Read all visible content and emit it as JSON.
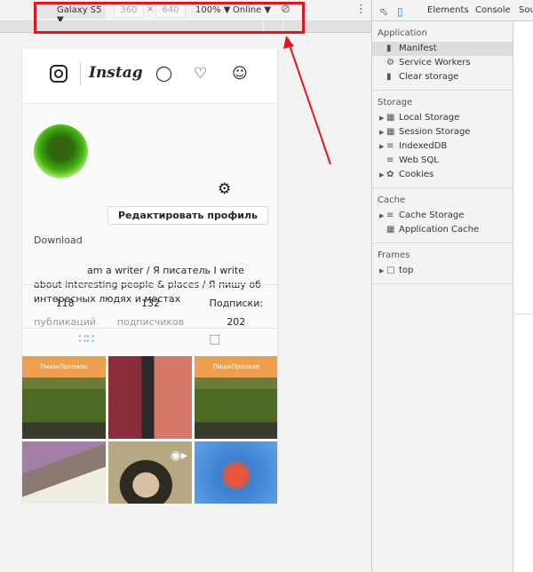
{
  "device_toolbar": {
    "device": "Galaxy S5 ▼",
    "width": "360",
    "times": "×",
    "height": "640",
    "zoom": "100% ▼",
    "network": "Online ▼",
    "rotate_icon": "rotate-icon",
    "menu_icon": "⋮"
  },
  "devtools": {
    "tabs": [
      "Elements",
      "Console",
      "Sou"
    ],
    "sections": [
      {
        "title": "Application",
        "items": [
          {
            "label": "Manifest",
            "icon": "▮",
            "selected": true
          },
          {
            "label": "Service Workers",
            "icon": "⚙"
          },
          {
            "label": "Clear storage",
            "icon": "▮"
          }
        ]
      },
      {
        "title": "Storage",
        "items": [
          {
            "label": "Local Storage",
            "icon": "▦",
            "expand": true
          },
          {
            "label": "Session Storage",
            "icon": "▦",
            "expand": true
          },
          {
            "label": "IndexedDB",
            "icon": "≡",
            "expand": true
          },
          {
            "label": "Web SQL",
            "icon": "≡"
          },
          {
            "label": "Cookies",
            "icon": "✿",
            "expand": true
          }
        ]
      },
      {
        "title": "Cache",
        "items": [
          {
            "label": "Cache Storage",
            "icon": "≡",
            "expand": true
          },
          {
            "label": "Application Cache",
            "icon": "▦"
          }
        ]
      },
      {
        "title": "Frames",
        "items": [
          {
            "label": "top",
            "icon": "□",
            "expand": true
          }
        ]
      }
    ]
  },
  "instagram": {
    "wordmark": "Instagram",
    "avatar_label": "Download",
    "edit_button": "Редактировать профиль",
    "bio": "am a writer / Я писатель I write about interesting people & places / Я пишу об интересных людях и местах",
    "stats": [
      {
        "value": "118",
        "label": "публикаций"
      },
      {
        "value": "132",
        "label": "подписчиков"
      },
      {
        "label": "Подписки:",
        "value": "202"
      }
    ],
    "post_banner": "ПишиПропало"
  },
  "annotation_color": "#e8141c"
}
